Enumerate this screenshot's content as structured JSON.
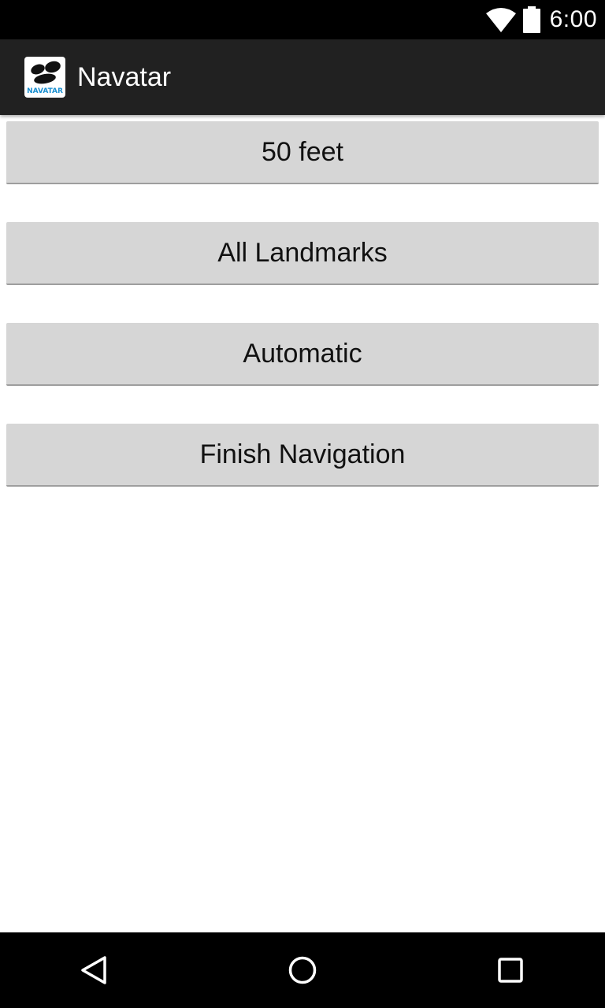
{
  "status_bar": {
    "time": "6:00",
    "icons": [
      "wifi-icon",
      "battery-icon"
    ]
  },
  "action_bar": {
    "title": "Navatar",
    "logo_icon": "navatar-logo-icon",
    "logo_text": "NAVATAR",
    "logo_text_color": "#1a8fd0"
  },
  "buttons": [
    {
      "label": "50 feet"
    },
    {
      "label": "All Landmarks"
    },
    {
      "label": "Automatic"
    },
    {
      "label": "Finish Navigation"
    }
  ],
  "nav_bar": {
    "icons": [
      "back-icon",
      "home-icon",
      "recents-icon"
    ]
  },
  "colors": {
    "status_bar_bg": "#000000",
    "action_bar_bg": "#212121",
    "button_bg": "#d6d6d6",
    "page_bg": "#ffffff"
  }
}
